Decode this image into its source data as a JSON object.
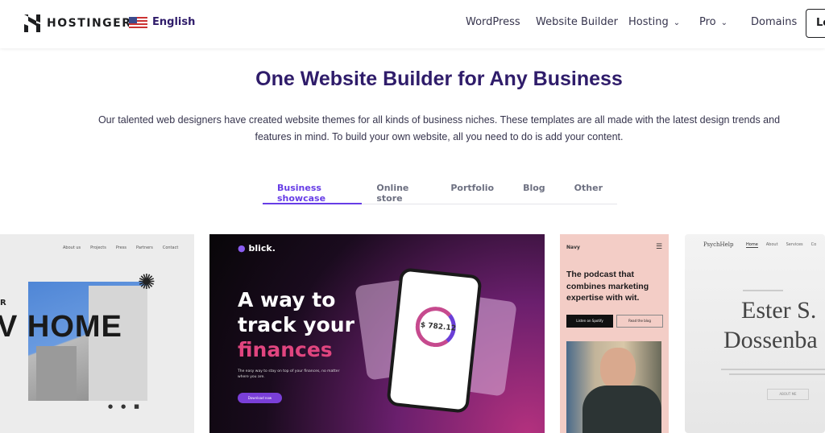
{
  "header": {
    "brand": "HOSTINGER",
    "language": "English",
    "nav": [
      {
        "label": "WordPress"
      },
      {
        "label": "Website Builder"
      },
      {
        "label": "Hosting"
      },
      {
        "label": "Pro"
      },
      {
        "label": "Domains"
      }
    ],
    "login": "Lo"
  },
  "hero": {
    "title": "One Website Builder for Any Business",
    "intro": "Our talented web designers have created website themes for all kinds of business niches. These templates are all made with the latest design trends and features in mind. To build your own website, all you need to do is add your content."
  },
  "tabs": [
    {
      "label": "Business showcase",
      "active": true
    },
    {
      "label": "Online store"
    },
    {
      "label": "Portfolio"
    },
    {
      "label": "Blog"
    },
    {
      "label": "Other"
    }
  ],
  "accent": "#673de6",
  "templates": {
    "home": {
      "nav": [
        "About us",
        "Projects",
        "Press",
        "Partners",
        "Contact"
      ],
      "headline_top": "R",
      "headline": "V HOME"
    },
    "blick": {
      "brand": "blick.",
      "line1": "A way to",
      "line2": "track your",
      "line3": "finances",
      "sub": "The easy way to stay on top of your finances, no matter where you are.",
      "cta": "Download now",
      "balance": "$ 782.12"
    },
    "navy": {
      "brand": "Navy",
      "headline": "The podcast that combines marketing expertise with wit.",
      "btn1": "Listen on Spotify",
      "btn2": "Read the blog"
    },
    "psych": {
      "brand": "PsychHelp",
      "nav": [
        "Home",
        "About",
        "Services",
        "Co"
      ],
      "name1": "Ester S.",
      "name2": "Dossenba",
      "cta": "ABOUT ME"
    }
  }
}
